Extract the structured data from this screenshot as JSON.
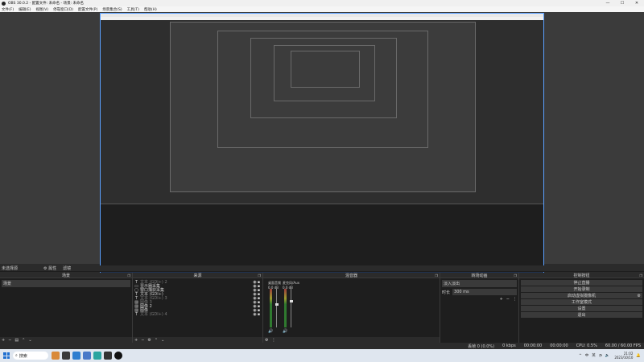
{
  "window": {
    "title": "OBS 30.0.2 - 配置文件: 未命名 - 场景: 未命名"
  },
  "menu": [
    "文件(F)",
    "编辑(E)",
    "视图(V)",
    "停靠窗口(D)",
    "配置文件(P)",
    "场景集合(S)",
    "工具(T)",
    "帮助(H)"
  ],
  "status_row": {
    "source_name": "未选择源",
    "properties": "⚙ 属性",
    "filters": "滤镜"
  },
  "docks": {
    "scenes": {
      "title": "场景",
      "items": [
        "场景"
      ]
    },
    "sources": {
      "title": "来源",
      "items": [
        {
          "icon": "text-icon",
          "name": "文本 (GDI+) 2",
          "dim": true
        },
        {
          "icon": "display-icon",
          "name": "显示器采集",
          "dim": false
        },
        {
          "icon": "window-icon",
          "name": "窗口捕获采集",
          "dim": false
        },
        {
          "icon": "text-icon",
          "name": "文本 (GDI+)",
          "dim": false
        },
        {
          "icon": "text-icon",
          "name": "文本 (GDI+) 3",
          "dim": true
        },
        {
          "icon": "image-icon",
          "name": "图像 3",
          "dim": true
        },
        {
          "icon": "image-icon",
          "name": "图像 2",
          "dim": false
        },
        {
          "icon": "image-icon",
          "name": "图像",
          "dim": false
        },
        {
          "icon": "text-icon",
          "name": "文本 (GDI+) 4",
          "dim": true
        }
      ]
    },
    "mixer": {
      "title": "混音器",
      "channels": [
        {
          "name": "桌面音频",
          "db": "0.0 dB",
          "level": 0.62
        },
        {
          "name": "麦克风/Aux",
          "db": "0.0 dB",
          "level": 0.7
        }
      ]
    },
    "transitions": {
      "title": "转场动画",
      "type": "淡入淡出",
      "duration_label": "时长",
      "duration": "300 ms"
    },
    "controls": {
      "title": "控制按钮",
      "buttons": [
        "停止直播",
        "开始录制",
        "启动虚拟摄像机",
        "工作室模式",
        "设置",
        "退出"
      ]
    }
  },
  "statusbar": {
    "dropped": "丢帧 0 (0.0%)",
    "bitrate": "0 kbps",
    "live_time": "00:00:00",
    "rec_time": "00:00:00",
    "cpu": "CPU: 0.5%",
    "fps": "60.00 / 60.00 FPS"
  },
  "taskbar": {
    "search_placeholder": "搜索",
    "tray": [
      "^",
      "中",
      "英"
    ],
    "time": "21:02",
    "date": "2023/10/10"
  },
  "colors": {
    "accent": "#5aa0ff",
    "dock_bg": "#1e1e1e",
    "panel_bg": "#2b2b2b"
  }
}
